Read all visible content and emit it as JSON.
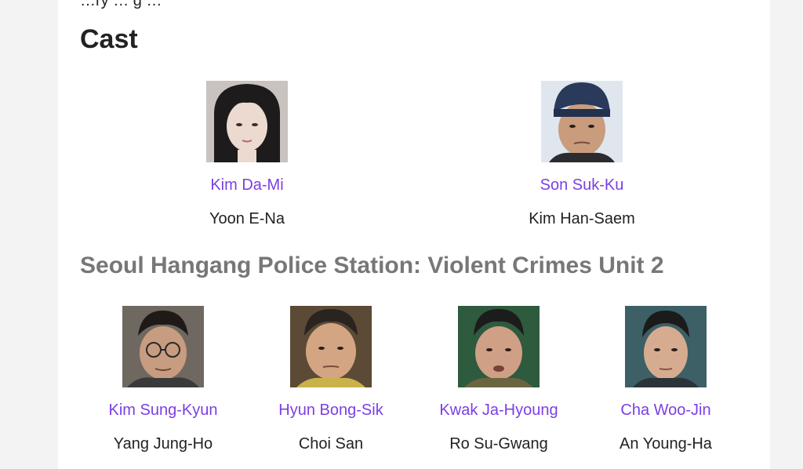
{
  "cut_text": "…ry … g …",
  "cast_heading": "Cast",
  "unit_heading": "Seoul Hangang Police Station: Violent Crimes Unit 2",
  "main_cast": [
    {
      "actor": "Kim Da-Mi",
      "role": "Yoon E-Na"
    },
    {
      "actor": "Son Suk-Ku",
      "role": "Kim Han-Saem"
    }
  ],
  "unit_cast": [
    {
      "actor": "Kim Sung-Kyun",
      "role": "Yang Jung-Ho"
    },
    {
      "actor": "Hyun Bong-Sik",
      "role": "Choi San"
    },
    {
      "actor": "Kwak Ja-Hyoung",
      "role": "Ro Su-Gwang"
    },
    {
      "actor": "Cha Woo-Jin",
      "role": "An Young-Ha"
    }
  ],
  "colors": {
    "link": "#7b3fe4",
    "heading": "#222222",
    "subheading": "#777777"
  }
}
